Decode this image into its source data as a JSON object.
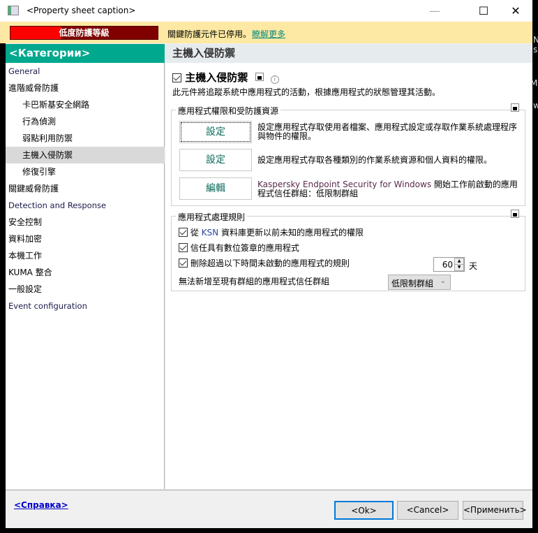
{
  "window": {
    "title": "<Property sheet caption>",
    "minimize": "—",
    "maximize": "☐",
    "close": "✕"
  },
  "banner": {
    "level": "低度防護等級",
    "level_fraction": 0.34,
    "message": "關鍵防護元件已停用。",
    "link": "瞭解更多"
  },
  "sidebar": {
    "header": "<Категории>",
    "items": [
      {
        "label": "General",
        "sub": false,
        "en": true
      },
      {
        "label": "進階威脅防護",
        "sub": false
      },
      {
        "label": "卡巴斯基安全網路",
        "sub": true
      },
      {
        "label": "行為偵測",
        "sub": true
      },
      {
        "label": "弱點利用防禦",
        "sub": true
      },
      {
        "label": "主機入侵防禦",
        "sub": true,
        "selected": true
      },
      {
        "label": "修復引擎",
        "sub": true
      },
      {
        "label": "關鍵威脅防護",
        "sub": false
      },
      {
        "label": "Detection and Response",
        "sub": false,
        "en": true
      },
      {
        "label": "安全控制",
        "sub": false
      },
      {
        "label": "資料加密",
        "sub": false
      },
      {
        "label": "本機工作",
        "sub": false
      },
      {
        "label": "KUMA 整合",
        "sub": false
      },
      {
        "label": "一般設定",
        "sub": false
      },
      {
        "label": "Event configuration",
        "sub": false,
        "en": true
      }
    ]
  },
  "main": {
    "header": "主機入侵防禦",
    "component_title": "主機入侵防禦",
    "component_desc": "此元件將追蹤系統中應用程式的活動，根據應用程式的狀態管理其活動。",
    "group1": {
      "label": "應用程式權限和受防護資源",
      "rows": [
        {
          "button": "設定",
          "desc": "設定應用程式存取使用者檔案、應用程式設定或存取作業系統處理程序與物件的權限。"
        },
        {
          "button": "設定",
          "desc": "設定應用程式存取各種類別的作業系統資源和個人資料的權限。"
        },
        {
          "button": "編輯",
          "desc_brand": "Kaspersky Endpoint Security for Windows",
          "desc": " 開始工作前啟動的應用程式信任群組：低限制群組"
        }
      ]
    },
    "group2": {
      "label": "應用程式處理規則",
      "cb1_pre": "從 ",
      "cb1_ksn": "KSN",
      "cb1_post": " 資料庫更新以前未知的應用程式的權限",
      "cb2": "信任具有數位簽章的應用程式",
      "cb3": "刪除超過以下時間未啟動的應用程式的規則",
      "days_value": "60",
      "days_unit": "天",
      "group_label": "無法新增至現有群組的應用程式信任群組",
      "group_value": "低限制群組"
    }
  },
  "footer": {
    "help": "<Справка>",
    "ok": "<Ok>",
    "cancel": "<Cancel>",
    "apply": "<Применить>"
  },
  "background_fragments": [
    "N",
    "s",
    "Ma",
    "wi"
  ]
}
